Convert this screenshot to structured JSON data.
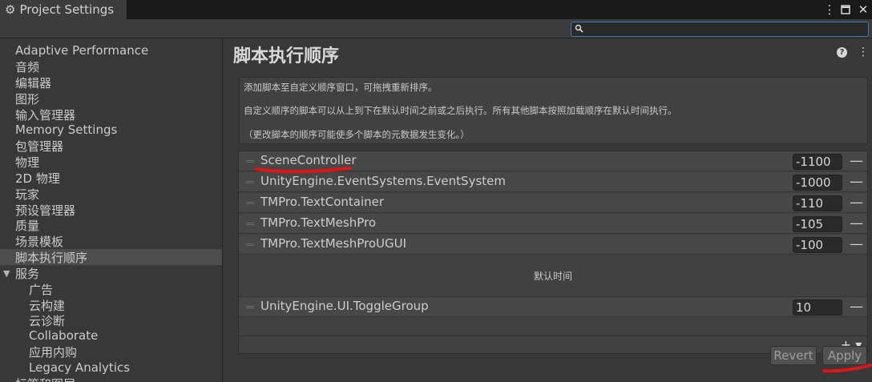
{
  "window": {
    "title": "Project Settings",
    "kebab_icon": "kebab-icon",
    "maximize_icon": "maximize-icon",
    "close_icon": "close-icon"
  },
  "search": {
    "value": "",
    "icon": "search-icon"
  },
  "sidebar": {
    "items": [
      {
        "label": "Adaptive Performance"
      },
      {
        "label": "音频"
      },
      {
        "label": "编辑器"
      },
      {
        "label": "图形"
      },
      {
        "label": "输入管理器"
      },
      {
        "label": "Memory Settings"
      },
      {
        "label": "包管理器"
      },
      {
        "label": "物理"
      },
      {
        "label": "2D 物理"
      },
      {
        "label": "玩家"
      },
      {
        "label": "预设管理器"
      },
      {
        "label": "质量"
      },
      {
        "label": "场景模板"
      },
      {
        "label": "脚本执行顺序",
        "selected": true
      },
      {
        "label": "服务",
        "expanded": true
      },
      {
        "label": "广告",
        "child": true
      },
      {
        "label": "云构建",
        "child": true
      },
      {
        "label": "云诊断",
        "child": true
      },
      {
        "label": "Collaborate",
        "child": true
      },
      {
        "label": "应用内购",
        "child": true
      },
      {
        "label": "Legacy Analytics",
        "child": true
      },
      {
        "label": "标签和图层"
      }
    ]
  },
  "main": {
    "title": "脚本执行顺序",
    "help_icon": "help-icon",
    "info": {
      "line1": "添加脚本至自定义顺序窗口，可拖拽重新排序。",
      "line2": "自定义顺序的脚本可以从上到下在默认时间之前或之后执行。所有其他脚本按照加载顺序在默认时间执行。",
      "line3": "（更改脚本的顺序可能使多个脚本的元数据发生变化。）"
    },
    "scripts_before": [
      {
        "name": "SceneController",
        "order": "-1100"
      },
      {
        "name": "UnityEngine.EventSystems.EventSystem",
        "order": "-1000"
      },
      {
        "name": "TMPro.TextContainer",
        "order": "-110"
      },
      {
        "name": "TMPro.TextMeshPro",
        "order": "-105"
      },
      {
        "name": "TMPro.TextMeshProUGUI",
        "order": "-100"
      }
    ],
    "default_time_label": "默认时间",
    "scripts_after": [
      {
        "name": "UnityEngine.UI.ToggleGroup",
        "order": "10"
      }
    ],
    "add_button": "+ ▾",
    "remove_symbol": "—",
    "revert_label": "Revert",
    "apply_label": "Apply"
  },
  "colors": {
    "background": "#383838",
    "annotation_red": "#e01515"
  }
}
